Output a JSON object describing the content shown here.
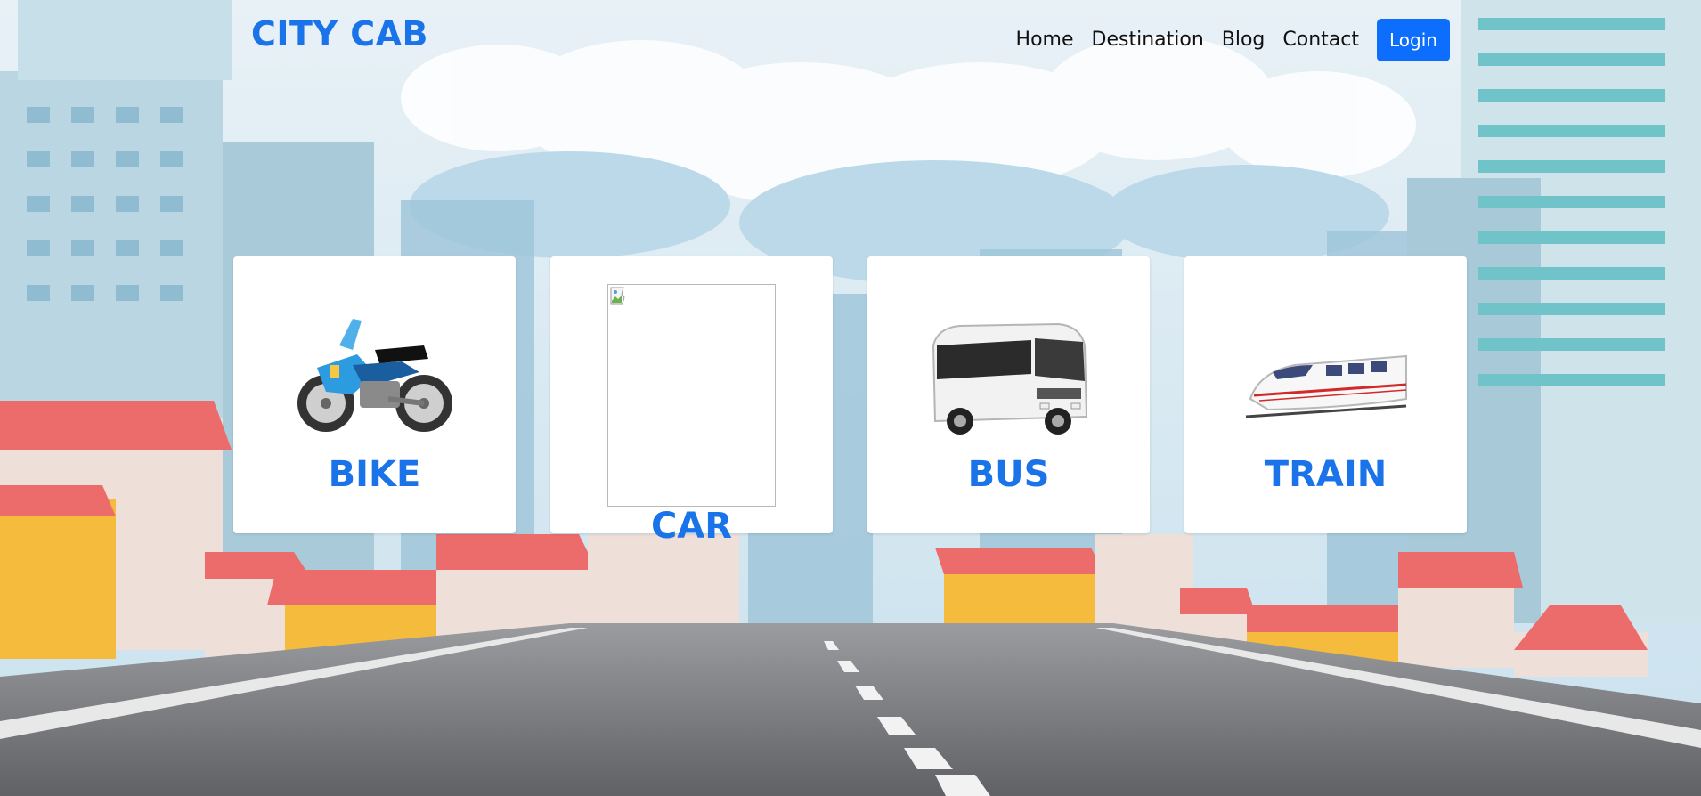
{
  "brand": {
    "name": "CITY CAB"
  },
  "nav": {
    "links": [
      "Home",
      "Destination",
      "Blog",
      "Contact"
    ],
    "login_label": "Login"
  },
  "cards": [
    {
      "title": "BIKE",
      "icon": "motorcycle-icon"
    },
    {
      "title": "CAR",
      "icon": "broken-image-icon"
    },
    {
      "title": "BUS",
      "icon": "bus-icon"
    },
    {
      "title": "TRAIN",
      "icon": "train-icon"
    }
  ],
  "colors": {
    "brand": "#1a73e8",
    "login_button": "#0d6efd",
    "card_background": "#ffffff",
    "nav_text": "#111111"
  }
}
